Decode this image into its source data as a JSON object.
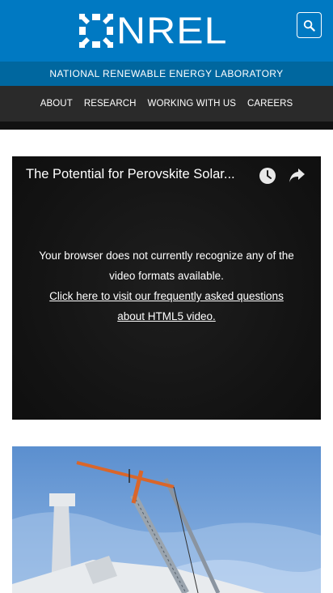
{
  "header": {
    "logo_text": "NREL",
    "search_icon": "search-icon",
    "brand_color": "#0079c2"
  },
  "subbar": {
    "text": "NATIONAL RENEWABLE ENERGY LABORATORY",
    "color": "#00679f"
  },
  "nav": {
    "items": [
      {
        "label": "ABOUT"
      },
      {
        "label": "RESEARCH"
      },
      {
        "label": "WORKING WITH US"
      },
      {
        "label": "CAREERS"
      }
    ]
  },
  "video": {
    "title": "The Potential for Perovskite Solar...",
    "watch_later_icon": "clock-icon",
    "share_icon": "share-icon",
    "message_line": "Your browser does not currently recognize any of the video formats available.",
    "faq_link": "Click here to visit our frequently asked questions about HTML5 video."
  },
  "photo": {
    "subject": "wind-turbine-crane-image"
  }
}
